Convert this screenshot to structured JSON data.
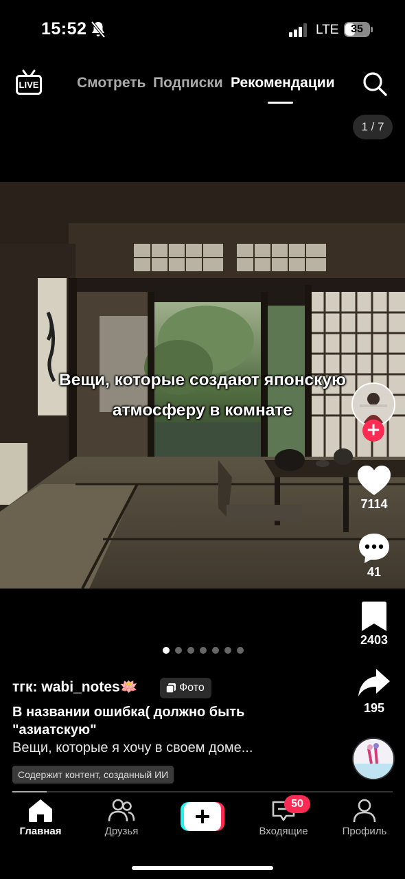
{
  "status_bar": {
    "time": "15:52",
    "network": "LTE",
    "battery": "35"
  },
  "top_nav": {
    "live_label": "LIVE",
    "tabs": [
      {
        "label": "Смотреть",
        "active": false
      },
      {
        "label": "Подписки",
        "active": false
      },
      {
        "label": "Рекомендации",
        "active": true
      }
    ]
  },
  "photo": {
    "counter": "1 / 7",
    "caption_line1": "Вещи, которые создают японскую",
    "caption_line2": "атмосферу в комнате",
    "slides_total": 7,
    "slide_active": 1
  },
  "actions": {
    "likes": "7114",
    "comments": "41",
    "bookmarks": "2403",
    "shares": "195"
  },
  "post": {
    "author": "тгк: wabi_notes",
    "author_emoji": "🪷",
    "type_badge": "Фото",
    "title": "В названии ошибка( должно быть \"азиатскую\"",
    "description": "Вещи, которые я хочу в своем доме...",
    "ai_label": "Содержит контент, созданный ИИ",
    "progress_fraction": 0.09
  },
  "bottom_nav": {
    "items": [
      {
        "label": "Главная",
        "active": true
      },
      {
        "label": "Друзья",
        "active": false
      },
      {
        "label": "",
        "active": false
      },
      {
        "label": "Входящие",
        "active": false
      },
      {
        "label": "Профиль",
        "active": false
      }
    ],
    "inbox_badge": "50"
  },
  "colors": {
    "accent": "#fe2c55",
    "background": "#000000",
    "cyan": "#25f4ee"
  }
}
